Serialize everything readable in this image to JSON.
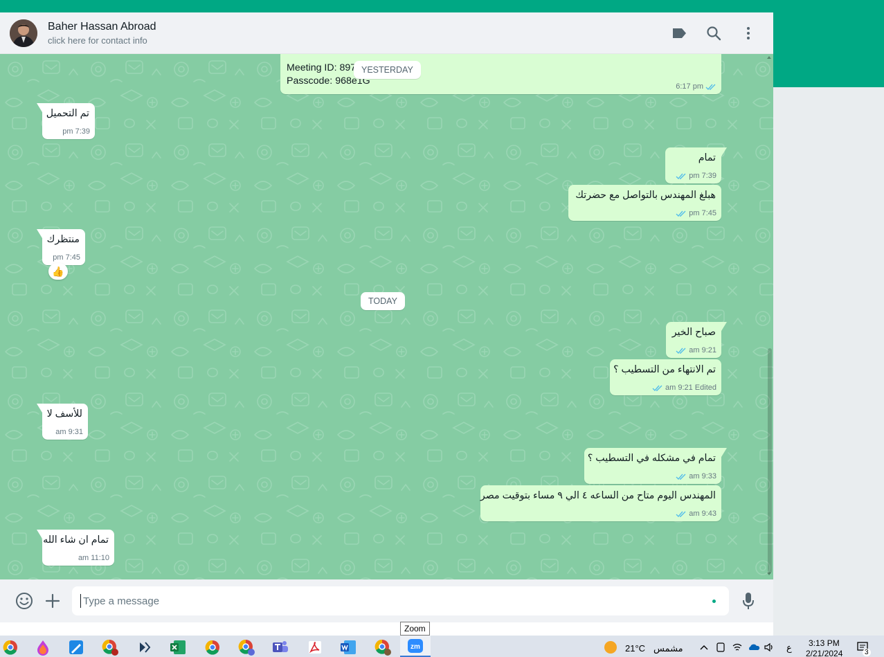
{
  "header": {
    "contact_name": "Baher Hassan Abroad",
    "contact_sub": "click here for contact info",
    "icons": [
      "label-icon",
      "search-icon",
      "menu-icon"
    ]
  },
  "day_labels": {
    "yesterday": "YESTERDAY",
    "today": "TODAY"
  },
  "messages": [
    {
      "direction": "out",
      "text_line1": "Meeting ID: 897",
      "text_line2": "Passcode: 968e1G",
      "time": "6:17 pm",
      "status": "read"
    },
    {
      "direction": "in",
      "text": "تم التحميل",
      "time": "7:39 pm"
    },
    {
      "direction": "out",
      "text": "تمام",
      "time": "7:39 pm",
      "status": "read"
    },
    {
      "direction": "out",
      "text": "هبلغ المهندس بالتواصل مع حضرتك",
      "time": "7:45 pm",
      "status": "read"
    },
    {
      "direction": "in",
      "text": "منتظرك",
      "time": "7:45 pm",
      "reaction": "👍"
    },
    {
      "direction": "out",
      "text": "صباح الخير",
      "time": "9:21 am",
      "status": "read"
    },
    {
      "direction": "out",
      "text": "تم الانتهاء من التسطيب ؟",
      "edited": "Edited",
      "time": "9:21 am",
      "status": "read"
    },
    {
      "direction": "in",
      "text": "للأسف لا",
      "time": "9:31 am"
    },
    {
      "direction": "out",
      "text": "تمام في مشكله في التسطيب ؟",
      "time": "9:33 am",
      "status": "read"
    },
    {
      "direction": "out",
      "text": "المهندس اليوم متاح من الساعه ٤ الي ٩ مساء بتوقيت مصر",
      "time": "9:43 am",
      "status": "read"
    },
    {
      "direction": "in",
      "text": "تمام ان شاء الله",
      "time": "11:10 am"
    }
  ],
  "composer": {
    "placeholder": "Type a message",
    "value": ""
  },
  "tooltip": "Zoom",
  "taskbar": {
    "apps": [
      "chrome",
      "paint",
      "photos",
      "chrome-profile",
      "app-arrows",
      "excel",
      "chrome",
      "chrome-profile-2",
      "teams",
      "acrobat",
      "word",
      "chrome-3",
      "zoom"
    ],
    "weather_temp": "21°C",
    "weather_label": "مشمس",
    "lang": "ع",
    "time": "3:13 PM",
    "date": "2/21/2024",
    "notifications": "3"
  },
  "colors": {
    "accent": "#00a884",
    "chat_bg": "#85cca3",
    "bubble_out": "#d9fdd3",
    "bubble_in": "#ffffff",
    "read_ticks": "#53bdeb"
  }
}
